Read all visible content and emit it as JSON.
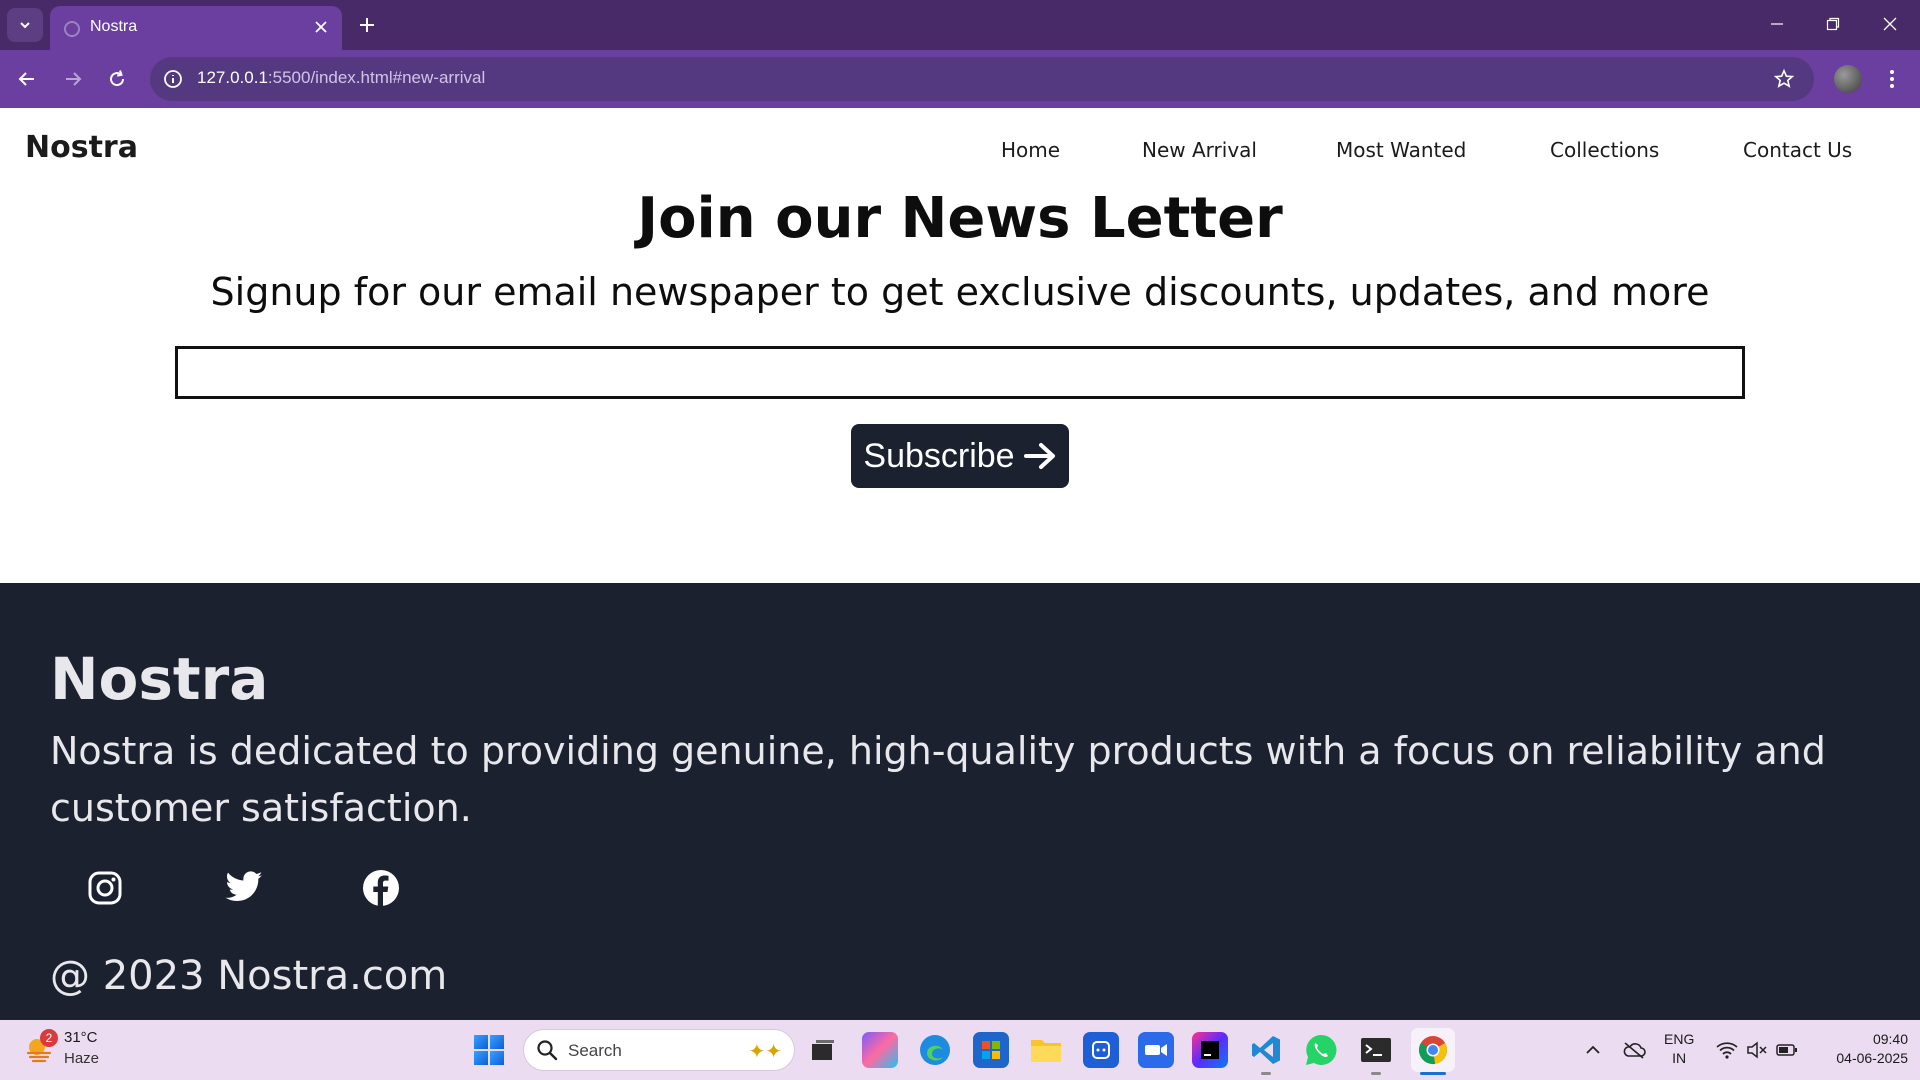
{
  "browser": {
    "tab_title": "Nostra",
    "url_host": "127.0.0.1",
    "url_rest": ":5500/index.html#new-arrival"
  },
  "site": {
    "brand": "Nostra",
    "nav": [
      "Home",
      "New Arrival",
      "Most Wanted",
      "Collections",
      "Contact Us"
    ]
  },
  "newsletter": {
    "title": "Join our News Letter",
    "subtitle": "Signup for our email newspaper to get exclusive discounts, updates, and more",
    "email_value": "",
    "button_label": "Subscribe"
  },
  "footer": {
    "brand": "Nostra",
    "description": "Nostra is dedicated to providing genuine, high-quality products with a focus on reliability and customer satisfaction.",
    "social": [
      "instagram-icon",
      "twitter-icon",
      "facebook-icon"
    ],
    "copyright": "@ 2023 Nostra.com",
    "background": "#1c2130"
  },
  "taskbar": {
    "weather_badge": "2",
    "weather_temp": "31°C",
    "weather_condition": "Haze",
    "search_placeholder": "Search",
    "lang_line1": "ENG",
    "lang_line2": "IN",
    "time": "09:40",
    "date": "04-06-2025"
  },
  "colors": {
    "tab_strip": "#472a67",
    "toolbar": "#6a3fa0",
    "button_dark": "#1c2130"
  }
}
